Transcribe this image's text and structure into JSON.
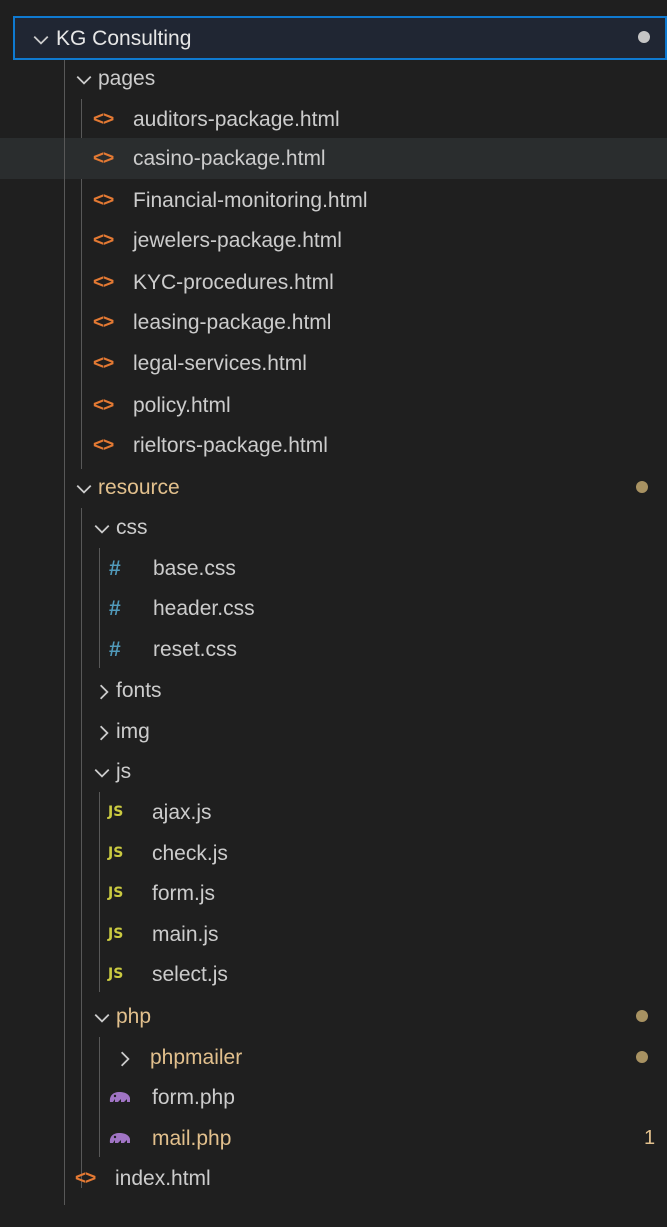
{
  "explorer": {
    "root": {
      "label": "KG Consulting",
      "expanded": true
    },
    "pages": {
      "label": "pages",
      "expanded": true,
      "files": [
        "auditors-package.html",
        "casino-package.html",
        "Financial-monitoring.html",
        "jewelers-package.html",
        "KYC-procedures.html",
        "leasing-package.html",
        "legal-services.html",
        "policy.html",
        "rieltors-package.html"
      ]
    },
    "resource": {
      "label": "resource",
      "expanded": true,
      "modified": true,
      "css": {
        "label": "css",
        "expanded": true,
        "files": [
          "base.css",
          "header.css",
          "reset.css"
        ]
      },
      "fonts": {
        "label": "fonts",
        "expanded": false
      },
      "img": {
        "label": "img",
        "expanded": false
      },
      "js": {
        "label": "js",
        "expanded": true,
        "files": [
          "ajax.js",
          "check.js",
          "form.js",
          "main.js",
          "select.js"
        ]
      },
      "php": {
        "label": "php",
        "expanded": true,
        "modified": true,
        "phpmailer": {
          "label": "phpmailer",
          "expanded": false,
          "modified": true
        },
        "files": [
          {
            "name": "form.php",
            "modified": false
          },
          {
            "name": "mail.php",
            "modified": true,
            "badge": "1"
          }
        ]
      }
    },
    "index": {
      "label": "index.html"
    }
  },
  "icons": {
    "html": "<>",
    "css": "#",
    "js": "JS",
    "php": "php-elephant-icon"
  },
  "colors": {
    "background": "#1f1f1f",
    "focus_border": "#0f7ad1",
    "hover_row": "#2a2d2e",
    "modified_text": "#e2c08d",
    "html_icon": "#e37933",
    "css_icon": "#519aba",
    "js_icon": "#cbcb41",
    "php_icon": "#a074c4"
  }
}
